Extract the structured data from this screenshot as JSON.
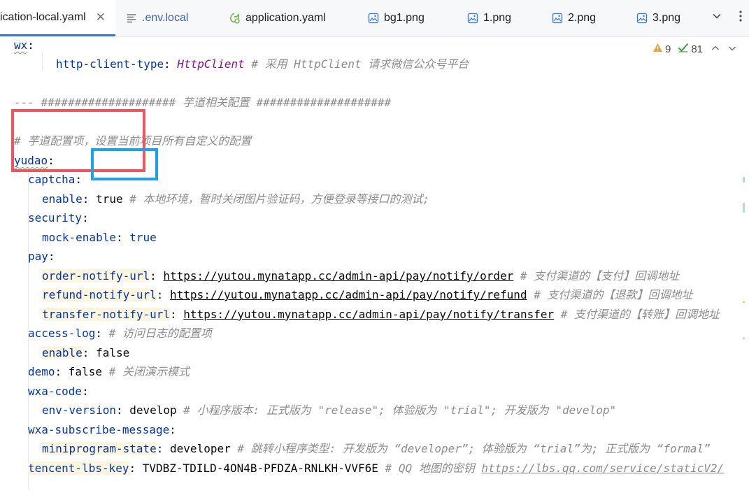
{
  "tabs": [
    {
      "label": "ication-local.yaml",
      "icon": "yaml-file-icon",
      "active": true,
      "closable": true
    },
    {
      "label": ".env.local",
      "icon": "text-file-icon"
    },
    {
      "label": "application.yaml",
      "icon": "spring-config-icon"
    },
    {
      "label": "bg1.png",
      "icon": "image-file-icon"
    },
    {
      "label": "1.png",
      "icon": "image-file-icon"
    },
    {
      "label": "2.png",
      "icon": "image-file-icon"
    },
    {
      "label": "3.png",
      "icon": "image-file-icon"
    }
  ],
  "inspection": {
    "warnings": "9",
    "passed": "81"
  },
  "colors": {
    "accent": "#3574f0",
    "annot_red": "#f2545b",
    "annot_blue": "#1aa3e8",
    "key": "#0033b3",
    "comment": "#8c8c8c"
  },
  "code": {
    "l1": {
      "key": "wx",
      "colon": ":"
    },
    "l2": {
      "key": "http-client-type",
      "colon": ": ",
      "value": "HttpClient",
      "comment": " # 采用 HttpClient 请求微信公众号平台"
    },
    "l4": {
      "text": "--- #################### 芋道相关配置 ####################"
    },
    "l6": {
      "text": "# 芋道配置项，设置当前项目所有自定义的配置"
    },
    "l7": {
      "key": "yudao",
      "colon": ":"
    },
    "l8": {
      "key": "captcha",
      "colon": ":"
    },
    "l9": {
      "key": "enable",
      "colon": ": ",
      "value": "true",
      "comment": " # 本地环境，暂时关闭图片验证码，方便登录等接口的测试;"
    },
    "l10": {
      "key": "security",
      "colon": ":"
    },
    "l11": {
      "key": "mock-enable",
      "colon": ": ",
      "value": "true"
    },
    "l12": {
      "key": "pay",
      "colon": ":"
    },
    "l13": {
      "key": "order-notify-url",
      "colon": ": ",
      "value": "https://yutou.mynatapp.cc/admin-api/pay/notify/order",
      "comment": " # 支付渠道的【支付】回调地址"
    },
    "l14": {
      "key": "refund-notify-url",
      "colon": ": ",
      "value": "https://yutou.mynatapp.cc/admin-api/pay/notify/refund",
      "comment": " # 支付渠道的【退款】回调地址"
    },
    "l15": {
      "key": "transfer-notify-url",
      "colon": ": ",
      "value": "https://yutou.mynatapp.cc/admin-api/pay/notify/transfer",
      "comment": " # 支付渠道的【转账】回调地址"
    },
    "l16": {
      "key": "access-log",
      "colon": ": ",
      "comment": "# 访问日志的配置项"
    },
    "l17": {
      "key": "enable",
      "colon": ": ",
      "value": "false"
    },
    "l18": {
      "key": "demo",
      "colon": ": ",
      "value": "false",
      "comment": " # 关闭演示模式"
    },
    "l19": {
      "key": "wxa-code",
      "colon": ":"
    },
    "l20": {
      "key": "env-version",
      "colon": ": ",
      "value": "develop",
      "comment": " # 小程序版本: 正式版为 \"release\"; 体验版为 \"trial\"; 开发版为 \"develop\""
    },
    "l21": {
      "key": "wxa-subscribe-message",
      "colon": ":"
    },
    "l22": {
      "key": "miniprogram-state",
      "colon": ": ",
      "value": "developer",
      "comment": " # 跳转小程序类型: 开发版为 “developer”; 体验版为 “trial”为; 正式版为 “formal”"
    },
    "l23": {
      "key": "tencent-lbs-key",
      "colon": ": ",
      "value": "TVDBZ-TDILD-4ON4B-PFDZA-RNLKH-VVF6E",
      "comment": " # QQ 地图的密钥 ",
      "link": "https://lbs.qq.com/service/staticV2/"
    }
  }
}
